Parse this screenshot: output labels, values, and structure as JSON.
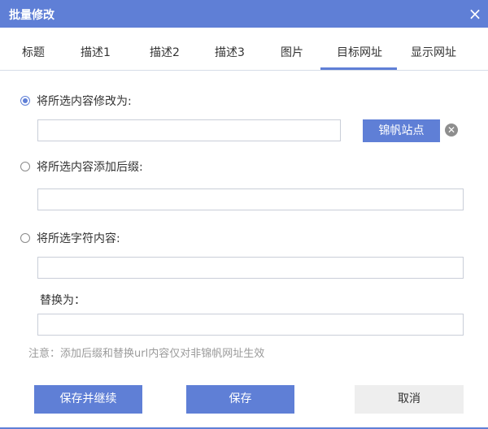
{
  "dialog": {
    "title": "批量修改"
  },
  "tabs": [
    {
      "label": "标题"
    },
    {
      "label": "描述1"
    },
    {
      "label": "描述2"
    },
    {
      "label": "描述3"
    },
    {
      "label": "图片"
    },
    {
      "label": "目标网址"
    },
    {
      "label": "显示网址"
    }
  ],
  "form": {
    "option_replace_label": "将所选内容修改为:",
    "option_replace_value": "",
    "site_button_label": "锦帆站点",
    "option_suffix_label": "将所选内容添加后缀:",
    "option_suffix_value": "",
    "option_chars_label": "将所选字符内容:",
    "option_chars_value": "",
    "replace_with_label": "替换为：",
    "replace_with_value": "",
    "note": "注意：添加后缀和替换url内容仅对非锦帆网址生效"
  },
  "buttons": {
    "save_continue": "保存并继续",
    "save": "保存",
    "cancel": "取消"
  },
  "colors": {
    "accent": "#5f7fd6",
    "muted": "#9a9a9a"
  },
  "icons": {
    "close": "close-icon",
    "clear": "clear-circle-icon"
  }
}
